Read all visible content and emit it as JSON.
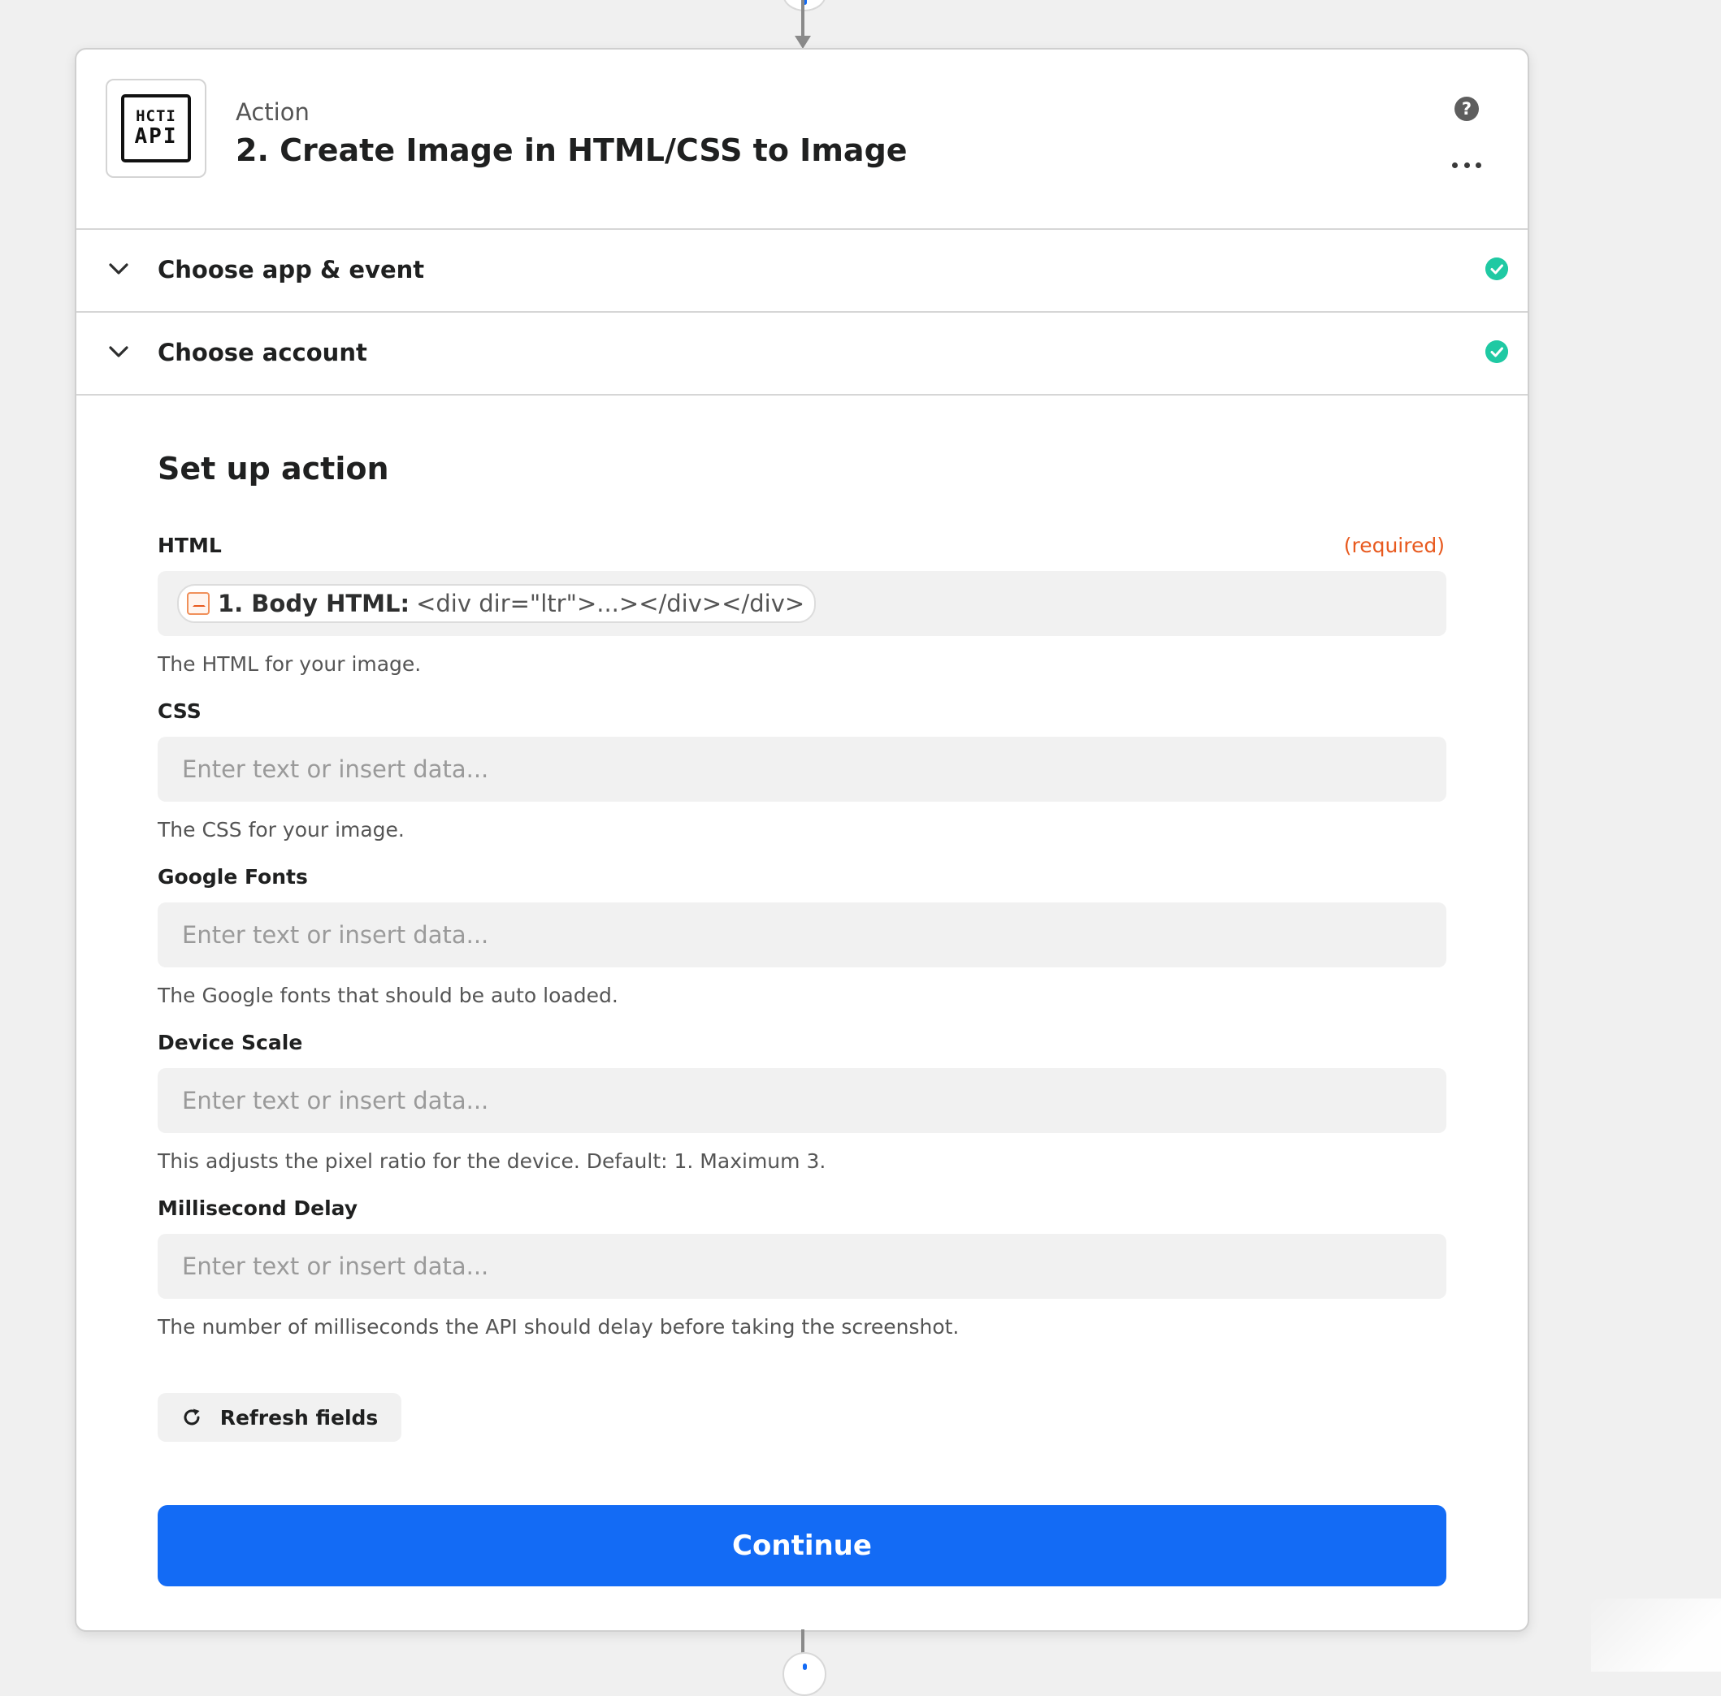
{
  "header": {
    "kicker": "Action",
    "title": "2. Create Image in HTML/CSS to Image",
    "logo_line1": "HCTI",
    "logo_line2": "API",
    "help_symbol": "?"
  },
  "sections": [
    {
      "label": "Choose app & event",
      "status": "complete"
    },
    {
      "label": "Choose account",
      "status": "complete"
    }
  ],
  "setup": {
    "title": "Set up action",
    "fields": [
      {
        "label": "HTML",
        "required_label": "(required)",
        "value": {
          "key": "1. Body HTML:",
          "val": "<div dir=\"ltr\">...></div></div>"
        },
        "help": "The HTML for your image."
      },
      {
        "label": "CSS",
        "placeholder": "Enter text or insert data...",
        "help": "The CSS for your image."
      },
      {
        "label": "Google Fonts",
        "placeholder": "Enter text or insert data...",
        "help": "The Google fonts that should be auto loaded."
      },
      {
        "label": "Device Scale",
        "placeholder": "Enter text or insert data...",
        "help": "This adjusts the pixel ratio for the device. Default: 1. Maximum 3."
      },
      {
        "label": "Millisecond Delay",
        "placeholder": "Enter text or insert data...",
        "help": "The number of milliseconds the API should delay before taking the screenshot."
      }
    ],
    "refresh_label": "Refresh fields",
    "continue_label": "Continue"
  },
  "colors": {
    "accent": "#136bf5",
    "success": "#1fc9a3",
    "required": "#e85a1f"
  },
  "icons": {
    "help": "help-icon",
    "more": "more-icon",
    "chevron": "chevron-down-icon",
    "check": "check-circle-icon",
    "refresh": "refresh-icon",
    "mail": "mail-icon"
  }
}
